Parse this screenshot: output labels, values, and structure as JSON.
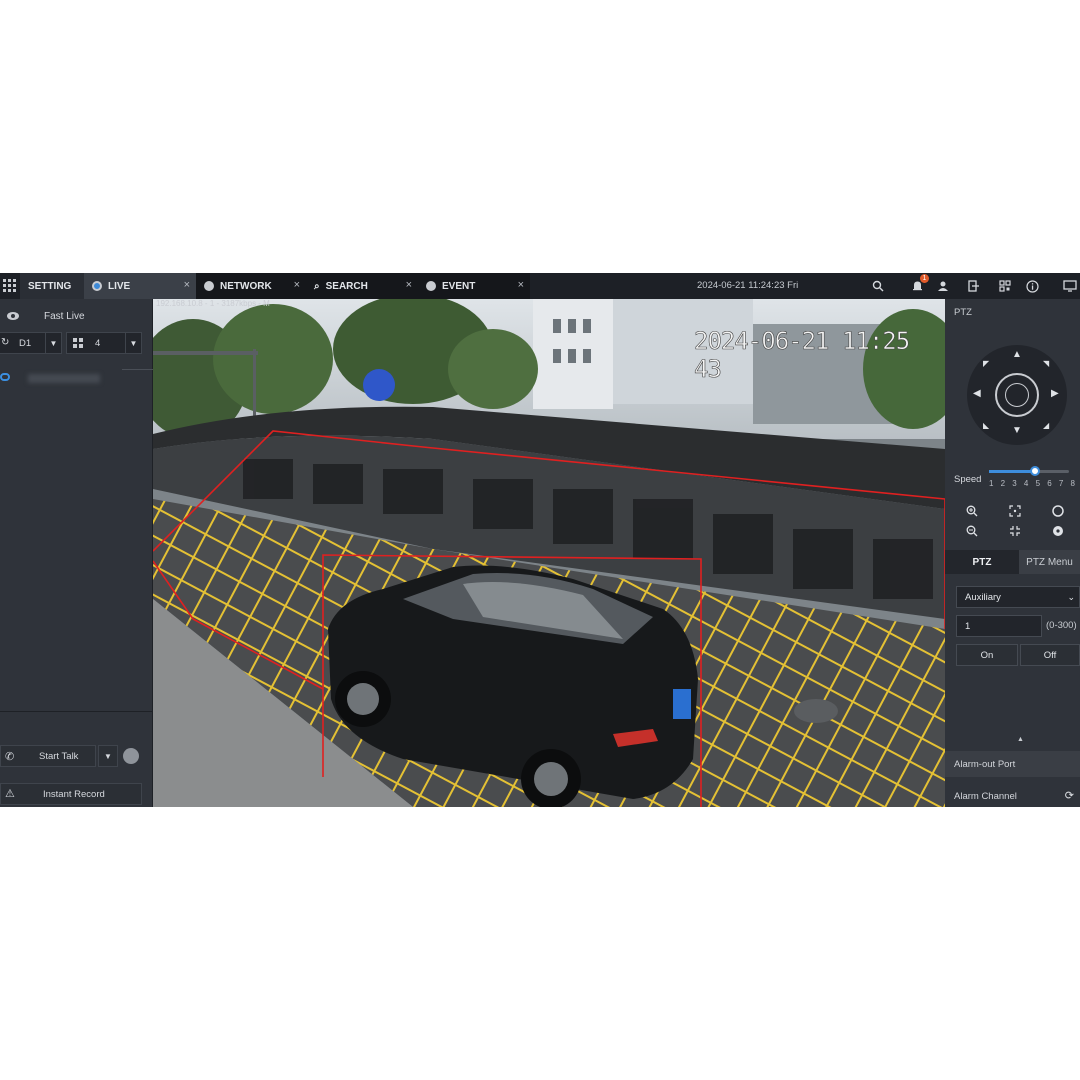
{
  "topbar": {
    "tabs": [
      {
        "label": "SETTING",
        "closable": false
      },
      {
        "label": "LIVE",
        "closable": true
      },
      {
        "label": "NETWORK",
        "closable": true
      },
      {
        "label": "SEARCH",
        "closable": true
      },
      {
        "label": "EVENT",
        "closable": true
      }
    ],
    "close_glyph": "×",
    "datetime": "2024-06-21 11:24:23 Fri",
    "alarm_count": "1",
    "icons": [
      "grid-menu-icon",
      "search-icon",
      "alarm-bell-icon",
      "user-icon",
      "logout-icon",
      "qr-code-icon",
      "info-icon",
      "monitor-icon"
    ]
  },
  "left_panel": {
    "fast_live_label": "Fast Live",
    "stream_value": "D1",
    "layout_value": "4",
    "start_talk_label": "Start Talk",
    "instant_record_label": "Instant Record"
  },
  "video": {
    "ip_label": "192.168.10.8 - 1 - 3187kbps - M",
    "osd_timestamp": "2024-06-21 11:25 43",
    "rule_color": "#e02020"
  },
  "right_panel": {
    "title": "PTZ",
    "speed_label": "Speed",
    "speed_ticks": [
      "1",
      "2",
      "3",
      "4",
      "5",
      "6",
      "7",
      "8"
    ],
    "speed_value": 5,
    "tabs": [
      {
        "label": "PTZ",
        "active": true
      },
      {
        "label": "PTZ Menu",
        "active": false
      }
    ],
    "auxiliary_value": "Auxiliary",
    "number_value": "1",
    "range_label": "(0-300)",
    "on_label": "On",
    "off_label": "Off",
    "alarm_out_label": "Alarm-out Port",
    "alarm_channel_label": "Alarm Channel"
  },
  "colors": {
    "accent": "#3d8ddc",
    "topbar_bg": "#1d2026",
    "panel_bg": "#2f333a",
    "badge": "#e05a2a"
  }
}
